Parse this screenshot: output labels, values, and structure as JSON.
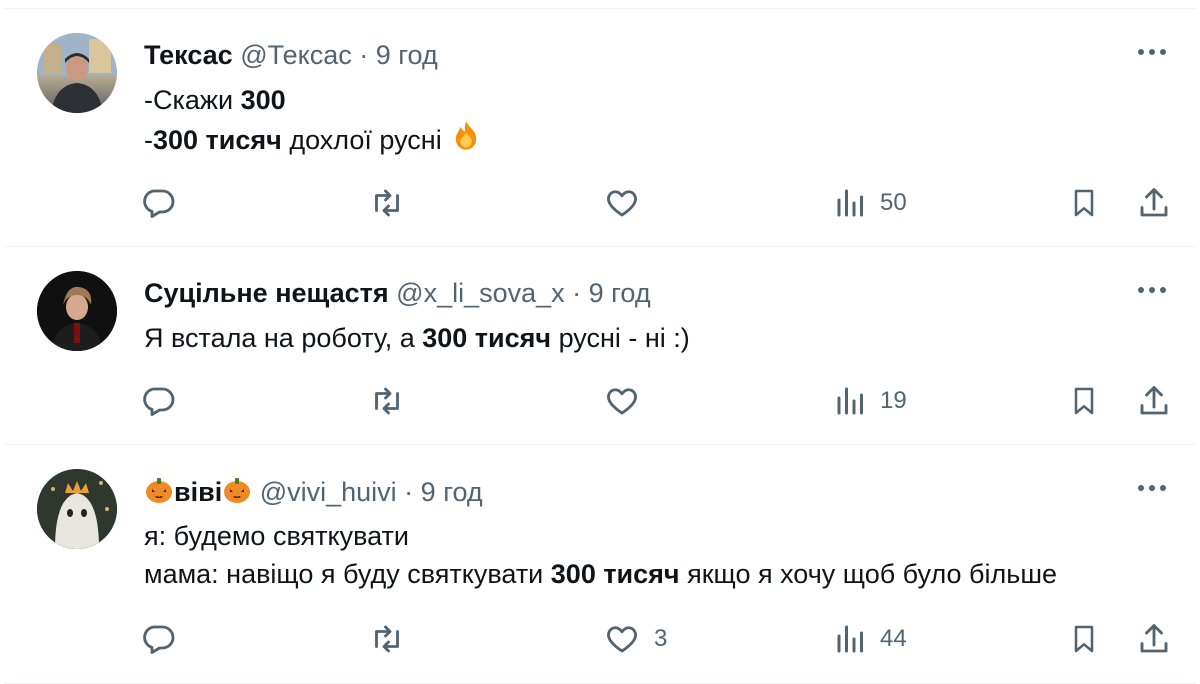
{
  "tweets": [
    {
      "name": "Тексас",
      "handle": "@Тексас",
      "time": "9 год",
      "lines": [
        [
          {
            "t": "-Скажи ",
            "b": false
          },
          {
            "t": "300",
            "b": true
          }
        ],
        [
          {
            "t": "-",
            "b": false
          },
          {
            "t": "300 тисяч",
            "b": true
          },
          {
            "t": " дохлої русні ",
            "b": false
          },
          {
            "emoji": "fire-emoji"
          }
        ]
      ],
      "likes": "",
      "views": "50"
    },
    {
      "name": "Суцільне нещастя",
      "handle": "@x_li_sova_x",
      "time": "9 год",
      "lines": [
        [
          {
            "t": "Я встала на роботу, а ",
            "b": false
          },
          {
            "t": "300 тисяч",
            "b": true
          },
          {
            "t": " русні - ні :)",
            "b": false
          }
        ]
      ],
      "likes": "",
      "views": "19"
    },
    {
      "name": "віві",
      "handle": "@vivi_huivi",
      "time": "9 год",
      "lines": [
        [
          {
            "t": "я: будемо святкувати",
            "b": false
          }
        ],
        [
          {
            "t": "мама: навіщо я буду святкувати ",
            "b": false
          },
          {
            "t": "300 тисяч",
            "b": true
          },
          {
            "t": " якщо я хочу щоб було більше",
            "b": false
          }
        ]
      ],
      "likes": "3",
      "views": "44"
    }
  ],
  "separator": " · ",
  "icons": [
    "reply-icon",
    "retweet-icon",
    "like-icon",
    "views-icon",
    "bookmark-icon",
    "share-icon",
    "more-icon",
    "pumpkin-emoji",
    "fire-emoji"
  ],
  "colors": {
    "text": "#0f1419",
    "secondary": "#536471",
    "divider": "#eff3f4"
  }
}
